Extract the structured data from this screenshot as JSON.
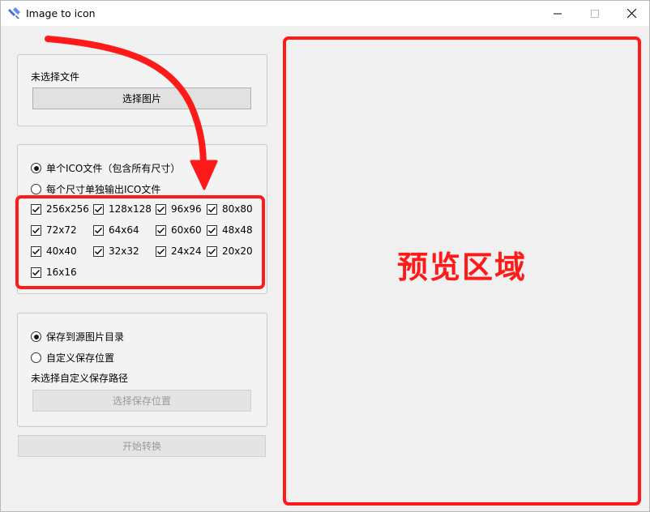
{
  "window": {
    "title": "Image to icon"
  },
  "file_group": {
    "status": "未选择文件",
    "select_image_button": "选择图片"
  },
  "mode_group": {
    "options": [
      {
        "label": "单个ICO文件（包含所有尺寸）",
        "selected": true
      },
      {
        "label": "每个尺寸单独输出ICO文件",
        "selected": false
      }
    ],
    "sizes": [
      {
        "label": "256x256",
        "checked": true
      },
      {
        "label": "128x128",
        "checked": true
      },
      {
        "label": "96x96",
        "checked": true
      },
      {
        "label": "80x80",
        "checked": true
      },
      {
        "label": "72x72",
        "checked": true
      },
      {
        "label": "64x64",
        "checked": true
      },
      {
        "label": "60x60",
        "checked": true
      },
      {
        "label": "48x48",
        "checked": true
      },
      {
        "label": "40x40",
        "checked": true
      },
      {
        "label": "32x32",
        "checked": true
      },
      {
        "label": "24x24",
        "checked": true
      },
      {
        "label": "20x20",
        "checked": true
      },
      {
        "label": "16x16",
        "checked": true
      }
    ]
  },
  "save_group": {
    "options": [
      {
        "label": "保存到源图片目录",
        "selected": true
      },
      {
        "label": "自定义保存位置",
        "selected": false
      }
    ],
    "custom_path_status": "未选择自定义保存路径",
    "choose_location_button": "选择保存位置"
  },
  "start_button": "开始转换",
  "preview": {
    "label": "预览区域"
  },
  "colors": {
    "annotation_red": "#ff1a1a",
    "window_bg": "#f0f0f0"
  }
}
